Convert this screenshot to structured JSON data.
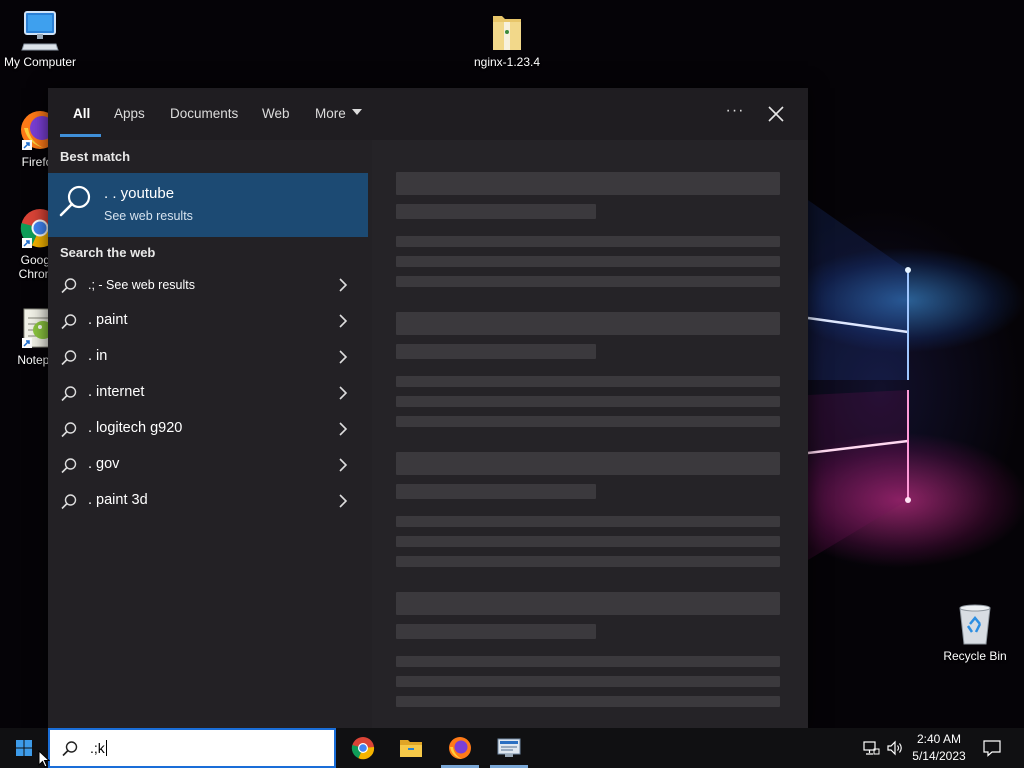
{
  "desktop": {
    "icons": [
      {
        "label": "My Computer"
      },
      {
        "label": "nginx-1.23.4"
      },
      {
        "label": "Firefox"
      },
      {
        "label": "Google Chrome"
      },
      {
        "label": "Notepad"
      },
      {
        "label": "Recycle Bin"
      }
    ]
  },
  "search_panel": {
    "tabs": [
      {
        "label": "All"
      },
      {
        "label": "Apps"
      },
      {
        "label": "Documents"
      },
      {
        "label": "Web"
      },
      {
        "label": "More"
      }
    ],
    "active_tab": "All",
    "best_match": {
      "heading": "Best match",
      "title": ". . youtube",
      "subtitle": "See web results"
    },
    "search_the_web": {
      "heading": "Search the web",
      "items": [
        {
          "label": ".; - See web results"
        },
        {
          "label": ". paint"
        },
        {
          "label": ". in"
        },
        {
          "label": ". internet"
        },
        {
          "label": ". logitech g920"
        },
        {
          "label": ". gov"
        },
        {
          "label": ". paint 3d"
        }
      ]
    }
  },
  "taskbar": {
    "search_query": ".;k",
    "clock": {
      "time": "2:40 AM",
      "date": "5/14/2023"
    },
    "pinned_apps": [
      "chrome-icon",
      "file-explorer-icon",
      "firefox-icon",
      "remote-desktop-icon"
    ]
  },
  "colors": {
    "accent": "#3f8fd8",
    "best_match_bg": "#1c4a73",
    "panel_bg": "#232125",
    "taskbar_bg": "#101012"
  }
}
